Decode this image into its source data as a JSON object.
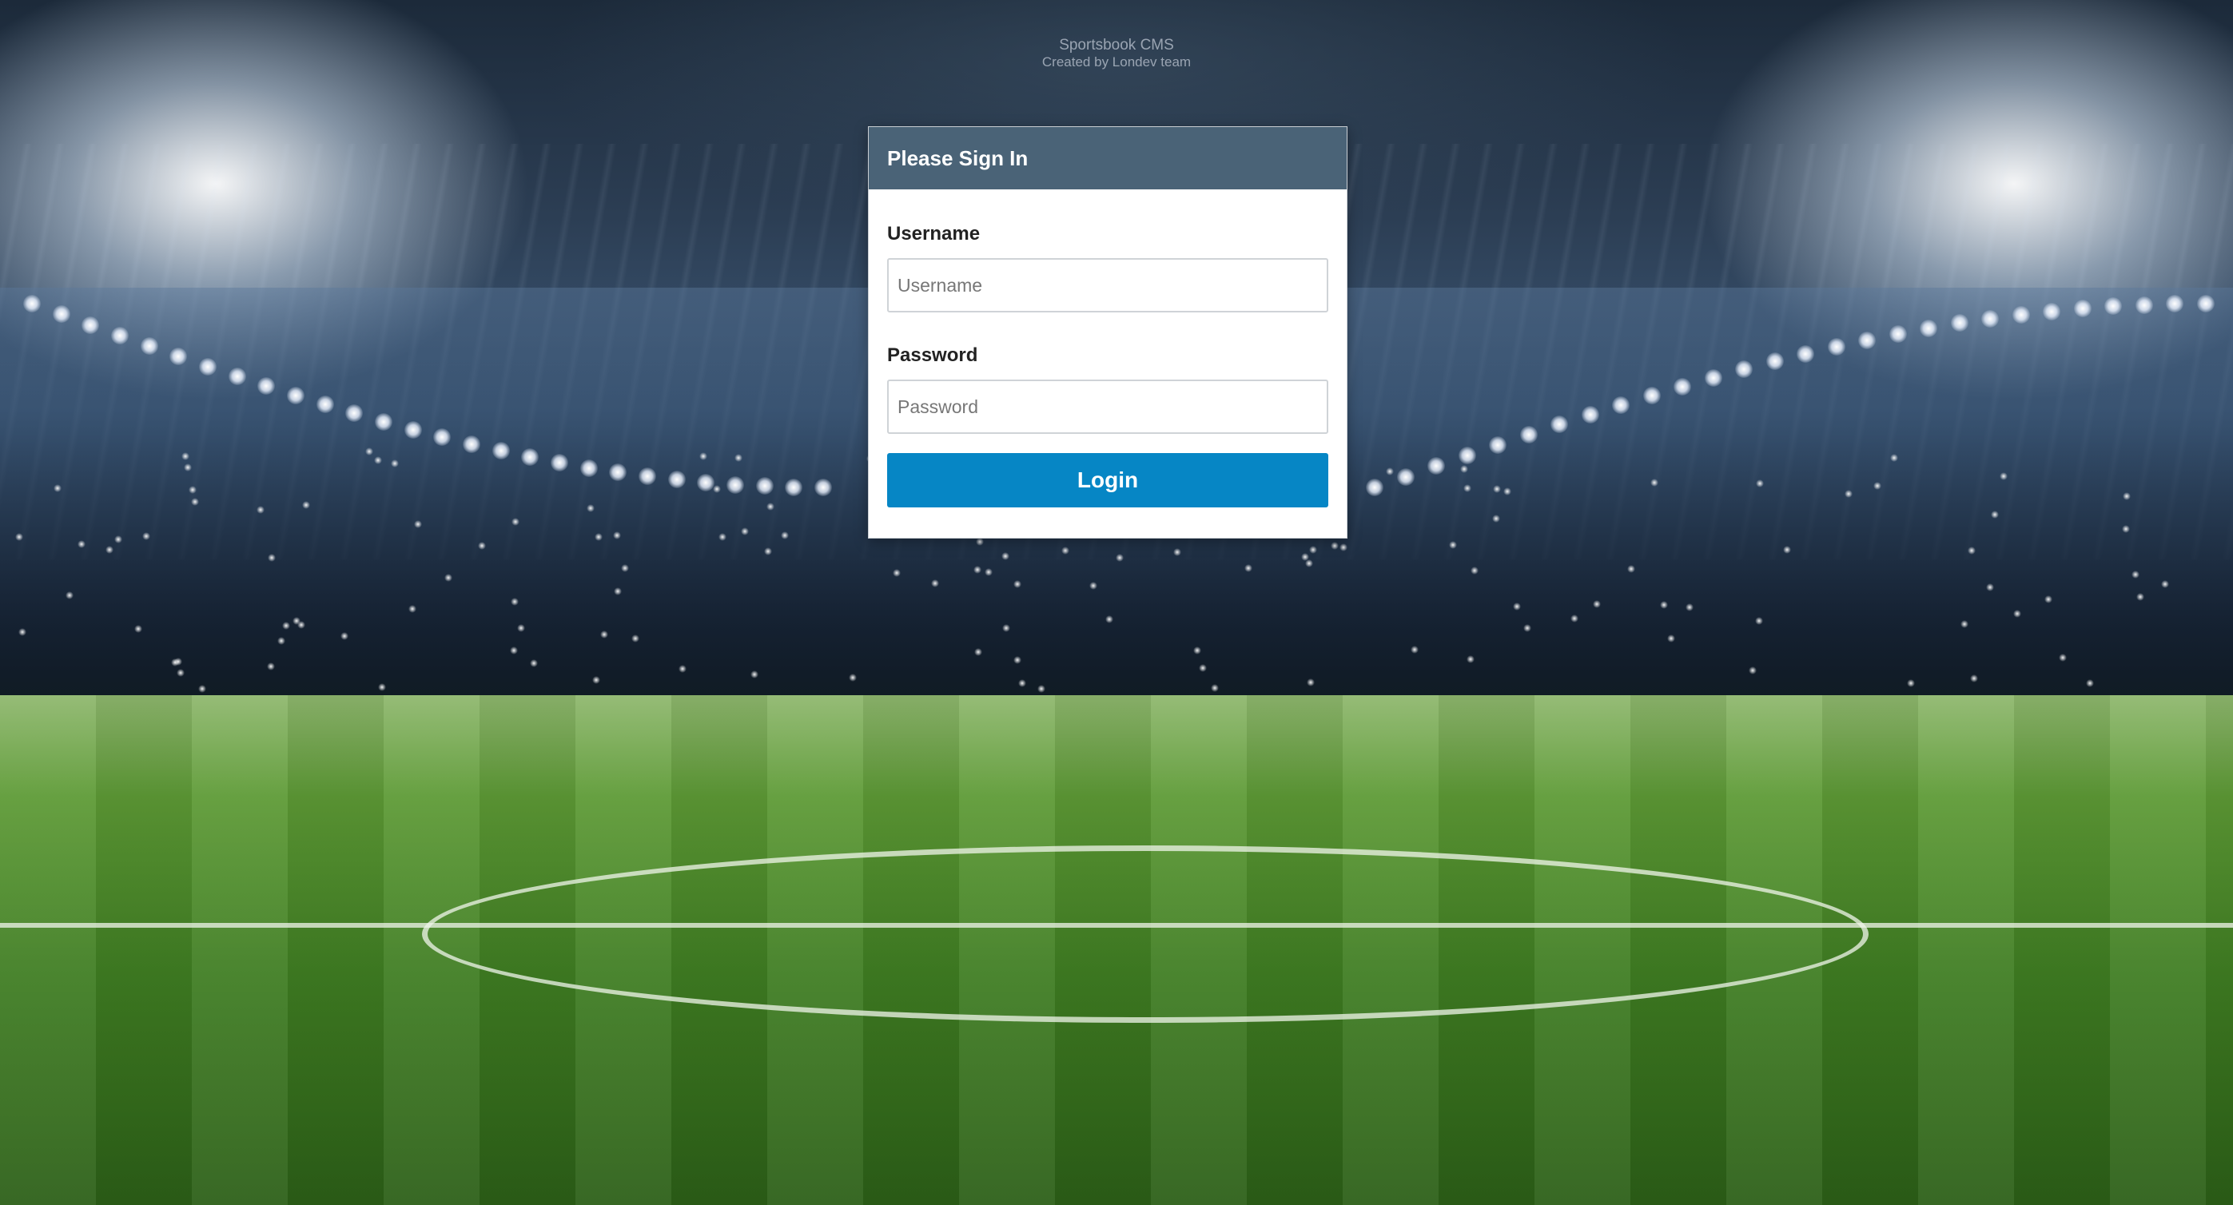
{
  "header": {
    "app_name": "Sportsbook CMS",
    "credit": "Created by Londev team"
  },
  "login_panel": {
    "title": "Please Sign In",
    "username": {
      "label": "Username",
      "placeholder": "Username",
      "value": ""
    },
    "password": {
      "label": "Password",
      "placeholder": "Password",
      "value": ""
    },
    "submit_label": "Login"
  },
  "colors": {
    "panel_heading_bg": "#4a6377",
    "login_button_bg": "#0686c5",
    "panel_bg": "#ffffff"
  },
  "background": {
    "scene": "stadium-pitch-image"
  }
}
